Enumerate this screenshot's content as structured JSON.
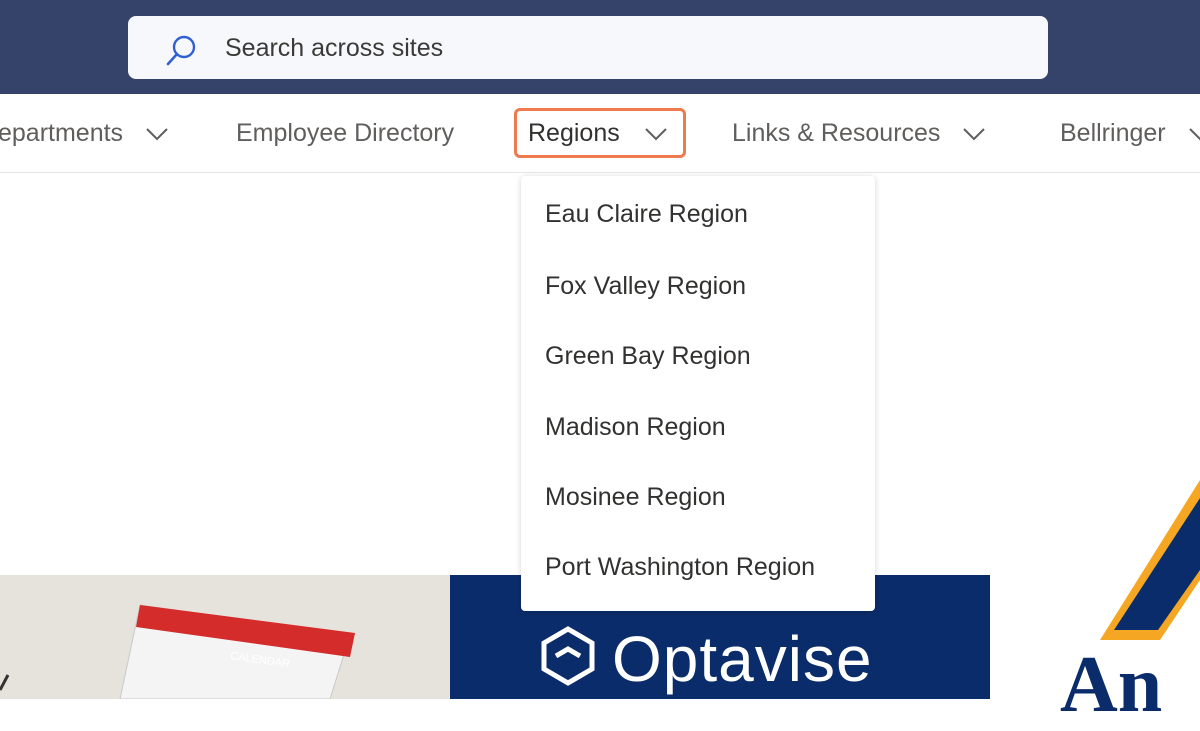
{
  "search": {
    "placeholder": "Search across sites"
  },
  "nav": {
    "items": [
      {
        "label": "epartments",
        "has_chevron": true
      },
      {
        "label": "Employee Directory",
        "has_chevron": false
      },
      {
        "label": "Regions",
        "has_chevron": true,
        "active": true
      },
      {
        "label": "Links & Resources",
        "has_chevron": true
      },
      {
        "label": "Bellringer",
        "has_chevron": true
      }
    ]
  },
  "regions_menu": {
    "items": [
      "Eau Claire Region",
      "Fox Valley Region",
      "Green Bay Region",
      "Madison Region",
      "Mosinee Region",
      "Port Washington Region"
    ]
  },
  "banners": {
    "calendar_label": "CALENDAR",
    "optavise_label": "Optavise",
    "ans_label": "An"
  },
  "colors": {
    "topbar": "#35426a",
    "highlight": "#ef7a4d",
    "optavise_bg": "#0b2c6b",
    "link_text": "#605e5c"
  },
  "icons": {
    "search": "search-icon",
    "chevron": "chevron-down-icon"
  }
}
